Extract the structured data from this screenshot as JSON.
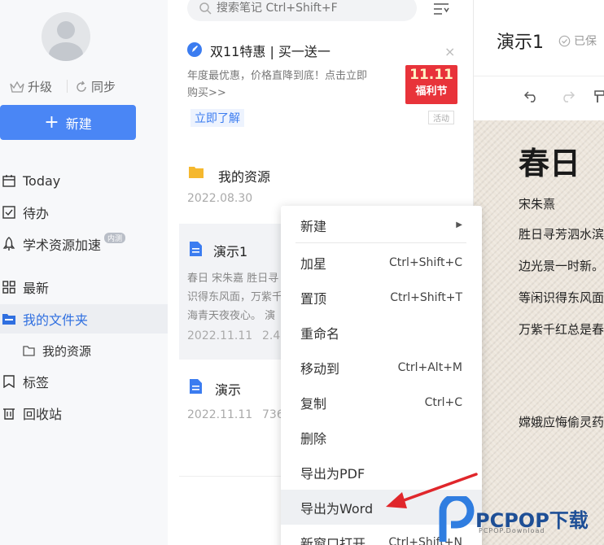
{
  "sidebar": {
    "upgrade_label": "升级",
    "sync_label": "同步",
    "new_button_label": "新建",
    "nav": [
      {
        "label": "Today",
        "icon": "calendar-icon"
      },
      {
        "label": "待办",
        "icon": "checkbox-icon"
      },
      {
        "label": "学术资源加速",
        "icon": "rocket-icon",
        "badge": "内测"
      },
      {
        "label": "最新",
        "icon": "grid-icon"
      },
      {
        "label": "我的文件夹",
        "icon": "folder-icon"
      },
      {
        "label": "我的资源",
        "icon": "folder-outline-icon"
      },
      {
        "label": "标签",
        "icon": "bookmark-icon"
      },
      {
        "label": "回收站",
        "icon": "trash-icon"
      }
    ]
  },
  "list": {
    "search_placeholder": "搜索笔记 Ctrl+Shift+F",
    "promo": {
      "title": "双11特惠 | 买一送一",
      "text_line1": "年度最优惠，价格直降到底！点击立即",
      "text_line2": "购买>>",
      "link": "立即了解",
      "badge_top": "11.11",
      "badge_bottom": "福利节",
      "tag": "活动",
      "close": "×"
    },
    "items": [
      {
        "title": "我的资源",
        "date": "2022.08.30"
      },
      {
        "title": "演示1",
        "snippet_line1": "春日 宋朱嘉 胜日寻",
        "snippet_line2": "识得东风面，万紫千",
        "snippet_line3": "海青天夜夜心。 演",
        "date": "2022.11.11",
        "size": "2.4"
      },
      {
        "title": "演示",
        "date": "2022.11.11",
        "size": "736"
      }
    ]
  },
  "context_menu": [
    {
      "label": "新建",
      "shortcut": "",
      "submenu": true
    },
    {
      "label": "加星",
      "shortcut": "Ctrl+Shift+C"
    },
    {
      "label": "置顶",
      "shortcut": "Ctrl+Shift+T"
    },
    {
      "label": "重命名",
      "shortcut": ""
    },
    {
      "label": "移动到",
      "shortcut": "Ctrl+Alt+M"
    },
    {
      "label": "复制",
      "shortcut": "Ctrl+C"
    },
    {
      "label": "删除",
      "shortcut": ""
    },
    {
      "label": "导出为PDF",
      "shortcut": ""
    },
    {
      "label": "导出为Word",
      "shortcut": ""
    },
    {
      "label": "新窗口打开",
      "shortcut": "Ctrl+Shift+N"
    }
  ],
  "editor": {
    "title": "演示1",
    "saved": "已保",
    "doc_heading": "春日",
    "lines": [
      "宋朱熹",
      "胜日寻芳泗水滨",
      "边光景一时新。",
      "等闲识得东风面",
      "万紫千红总是春",
      "嫦娥应悔偷灵药"
    ]
  },
  "watermark": {
    "brand": "PCPOP下载",
    "url": "PCPOP.Download"
  },
  "colors": {
    "accent": "#4a86f5",
    "arrow": "#e0262b",
    "promo_red": "#e8333a"
  }
}
